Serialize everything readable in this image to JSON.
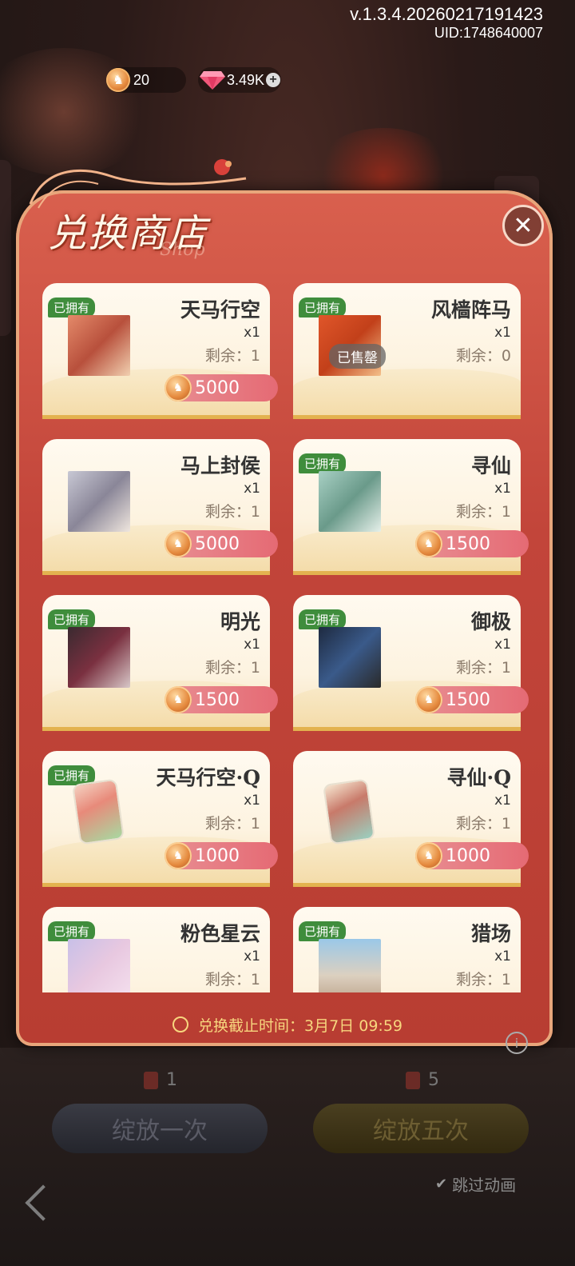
{
  "header": {
    "version": "v.1.3.4.20260217191423",
    "uid": "UID:1748640007"
  },
  "currency": {
    "token_amount": "20",
    "gem_amount": "3.49K"
  },
  "shop": {
    "title": "兑换商店",
    "deadline": "兑换截止时间：3月7日 09:59",
    "items": [
      {
        "name": "天马行空",
        "qty": "x1",
        "remain": "剩余：1",
        "price": "5000",
        "owned": "已拥有",
        "sold": ""
      },
      {
        "name": "风樯阵马",
        "qty": "x1",
        "remain": "剩余：0",
        "price": "",
        "owned": "已拥有",
        "sold": "已售罄"
      },
      {
        "name": "马上封侯",
        "qty": "x1",
        "remain": "剩余：1",
        "price": "5000",
        "owned": "",
        "sold": ""
      },
      {
        "name": "寻仙",
        "qty": "x1",
        "remain": "剩余：1",
        "price": "1500",
        "owned": "已拥有",
        "sold": ""
      },
      {
        "name": "明光",
        "qty": "x1",
        "remain": "剩余：1",
        "price": "1500",
        "owned": "已拥有",
        "sold": ""
      },
      {
        "name": "御极",
        "qty": "x1",
        "remain": "剩余：1",
        "price": "1500",
        "owned": "已拥有",
        "sold": ""
      },
      {
        "name": "天马行空·Q",
        "qty": "x1",
        "remain": "剩余：1",
        "price": "1000",
        "owned": "已拥有",
        "sold": ""
      },
      {
        "name": "寻仙·Q",
        "qty": "x1",
        "remain": "剩余：1",
        "price": "1000",
        "owned": "",
        "sold": ""
      },
      {
        "name": "粉色星云",
        "qty": "x1",
        "remain": "剩余：1",
        "price": "",
        "owned": "已拥有",
        "sold": ""
      },
      {
        "name": "猎场",
        "qty": "x1",
        "remain": "剩余：1",
        "price": "",
        "owned": "已拥有",
        "sold": ""
      }
    ]
  },
  "bottom": {
    "ticket_once": "1",
    "ticket_five": "5",
    "btn_once": "绽放一次",
    "btn_five": "绽放五次",
    "skip_label": "跳过动画"
  },
  "colors": {
    "panel": "#c2453a",
    "owned_badge": "#3f8d3c",
    "price_pill": "#e56a74",
    "deadline_text": "#f7d67e"
  },
  "icons": [
    "token-coin-icon",
    "gem-icon",
    "plus-icon",
    "close-icon",
    "clock-icon",
    "ticket-icon",
    "check-icon",
    "back-arrow-icon",
    "info-icon"
  ]
}
